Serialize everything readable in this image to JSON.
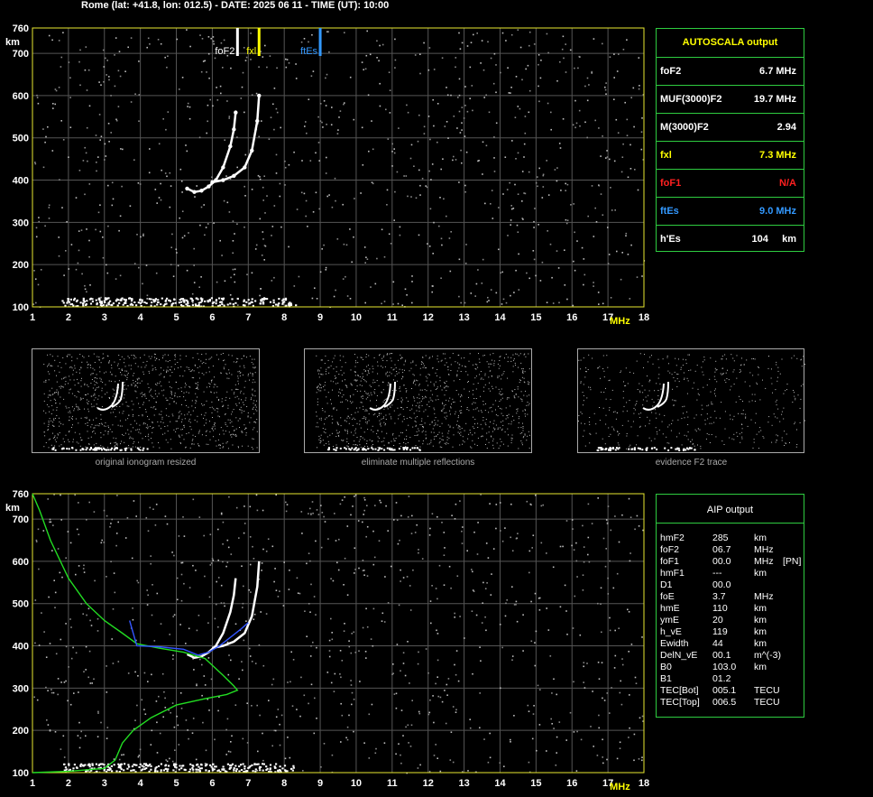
{
  "header": {
    "text": "Rome (lat: +41.8, lon: 012.5) - DATE: 2025 06 11 - TIME (UT): 10:00"
  },
  "chart_data": [
    {
      "type": "scatter",
      "title": "",
      "xlabel": "MHz",
      "ylabel": "km",
      "x_ticks": [
        "1",
        "2",
        "3",
        "4",
        "5",
        "6",
        "7",
        "8",
        "9",
        "10",
        "11",
        "12",
        "13",
        "14",
        "15",
        "16",
        "17",
        "18"
      ],
      "y_ticks": [
        "100",
        "200",
        "300",
        "400",
        "500",
        "600",
        "700",
        "760"
      ],
      "xlim": [
        1,
        18
      ],
      "ylim": [
        100,
        760
      ],
      "markers": [
        {
          "label": "foF2",
          "freq": 6.7,
          "color": "#ffffff"
        },
        {
          "label": "fxl",
          "freq": 7.3,
          "color": "#ffff00"
        },
        {
          "label": "ftEs",
          "freq": 9.0,
          "color": "#3399ff"
        }
      ],
      "series": [
        {
          "trace": "o",
          "x": [
            5.3,
            5.5,
            5.7,
            5.9,
            6.1,
            6.3,
            6.5,
            6.6,
            6.65
          ],
          "y": [
            380,
            372,
            375,
            385,
            400,
            430,
            480,
            520,
            560
          ]
        },
        {
          "trace": "x",
          "x": [
            6.0,
            6.3,
            6.6,
            6.9,
            7.1,
            7.25,
            7.3
          ],
          "y": [
            395,
            400,
            410,
            430,
            470,
            540,
            600
          ]
        }
      ]
    },
    {
      "type": "line",
      "title": "",
      "xlabel": "MHz",
      "ylabel": "km",
      "x_ticks": [
        "1",
        "2",
        "3",
        "4",
        "5",
        "6",
        "7",
        "8",
        "9",
        "10",
        "11",
        "12",
        "13",
        "14",
        "15",
        "16",
        "17",
        "18"
      ],
      "y_ticks": [
        "100",
        "200",
        "300",
        "400",
        "500",
        "600",
        "700",
        "760"
      ],
      "xlim": [
        1,
        18
      ],
      "ylim": [
        100,
        760
      ],
      "series": [
        {
          "trace": "profile",
          "x": [
            1.0,
            1.2,
            1.5,
            2.0,
            2.5,
            3.0,
            3.5,
            3.9,
            4.5,
            5.2,
            5.8,
            6.3,
            6.6,
            6.7,
            6.4,
            5.8,
            5.0,
            4.3,
            3.8,
            3.5,
            3.3,
            3.0,
            2.0,
            1.0
          ],
          "y": [
            760,
            720,
            650,
            560,
            500,
            460,
            430,
            405,
            395,
            385,
            370,
            330,
            305,
            295,
            285,
            275,
            260,
            230,
            200,
            170,
            130,
            110,
            103,
            100
          ]
        },
        {
          "trace": "recomputed",
          "x": [
            3.7,
            3.9,
            4.5,
            5.2,
            5.6,
            5.9,
            6.2,
            6.5,
            6.8,
            7.0
          ],
          "y": [
            460,
            400,
            398,
            392,
            378,
            385,
            400,
            420,
            440,
            455
          ]
        }
      ]
    }
  ],
  "autoscala": {
    "title": "AUTOSCALA output",
    "rows": [
      {
        "label": "foF2",
        "value": "6.7 MHz",
        "color": "#ffffff"
      },
      {
        "label": "MUF(3000)F2",
        "value": "19.7 MHz",
        "color": "#ffffff"
      },
      {
        "label": "M(3000)F2",
        "value": "2.94",
        "color": "#ffffff"
      },
      {
        "label": "fxl",
        "value": "7.3 MHz",
        "color": "#ffff00"
      },
      {
        "label": "foF1",
        "value": "N/A",
        "color": "#ff2020"
      },
      {
        "label": "ftEs",
        "value": "9.0 MHz",
        "color": "#3399ff"
      },
      {
        "label": "h'Es",
        "value": "104     km",
        "color": "#ffffff"
      }
    ]
  },
  "thumbnails": [
    {
      "caption": "original ionogram resized"
    },
    {
      "caption": "eliminate multiple reflections"
    },
    {
      "caption": "evidence F2 trace"
    }
  ],
  "aip": {
    "title": "AIP output",
    "rows": [
      {
        "name": "hmF2",
        "value": "285",
        "unit": "km",
        "extra": ""
      },
      {
        "name": "foF2",
        "value": "06.7",
        "unit": "MHz",
        "extra": ""
      },
      {
        "name": "foF1",
        "value": "00.0",
        "unit": "MHz",
        "extra": "[PN]"
      },
      {
        "name": "hmF1",
        "value": "---",
        "unit": "km",
        "extra": ""
      },
      {
        "name": "D1",
        "value": "00.0",
        "unit": "",
        "extra": ""
      },
      {
        "name": "foE",
        "value": "3.7",
        "unit": "MHz",
        "extra": ""
      },
      {
        "name": "hmE",
        "value": "110",
        "unit": "km",
        "extra": ""
      },
      {
        "name": "ymE",
        "value": "20",
        "unit": "km",
        "extra": ""
      },
      {
        "name": "h_vE",
        "value": "119",
        "unit": "km",
        "extra": ""
      },
      {
        "name": "Ewidth",
        "value": "44",
        "unit": "km",
        "extra": ""
      },
      {
        "name": "DelN_vE",
        "value": "00.1",
        "unit": "m^(-3)",
        "extra": ""
      },
      {
        "name": "B0",
        "value": "103.0",
        "unit": "km",
        "extra": ""
      },
      {
        "name": "B1",
        "value": "01.2",
        "unit": "",
        "extra": ""
      },
      {
        "name": "TEC[Bot]",
        "value": "005.1",
        "unit": "TECU",
        "extra": ""
      },
      {
        "name": "TEC[Top]",
        "value": "006.5",
        "unit": "TECU",
        "extra": ""
      }
    ]
  }
}
